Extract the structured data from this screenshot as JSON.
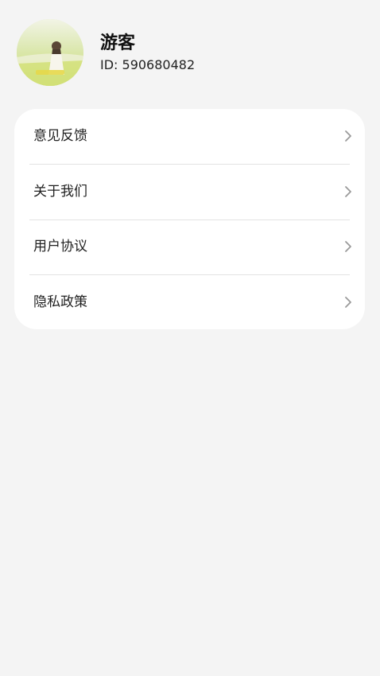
{
  "profile": {
    "nickname": "游客",
    "user_id": "ID:  590680482",
    "avatar_icon": "user-avatar"
  },
  "menu": {
    "items": [
      {
        "label": "意见反馈",
        "icon": "chevron-right-icon"
      },
      {
        "label": "关于我们",
        "icon": "chevron-right-icon"
      },
      {
        "label": "用户协议",
        "icon": "chevron-right-icon"
      },
      {
        "label": "隐私政策",
        "icon": "chevron-right-icon"
      }
    ]
  },
  "colors": {
    "background": "#f4f4f4",
    "card": "#ffffff",
    "text_primary": "#222222",
    "divider": "#e3e3e3",
    "chevron": "#9a9a9a"
  }
}
